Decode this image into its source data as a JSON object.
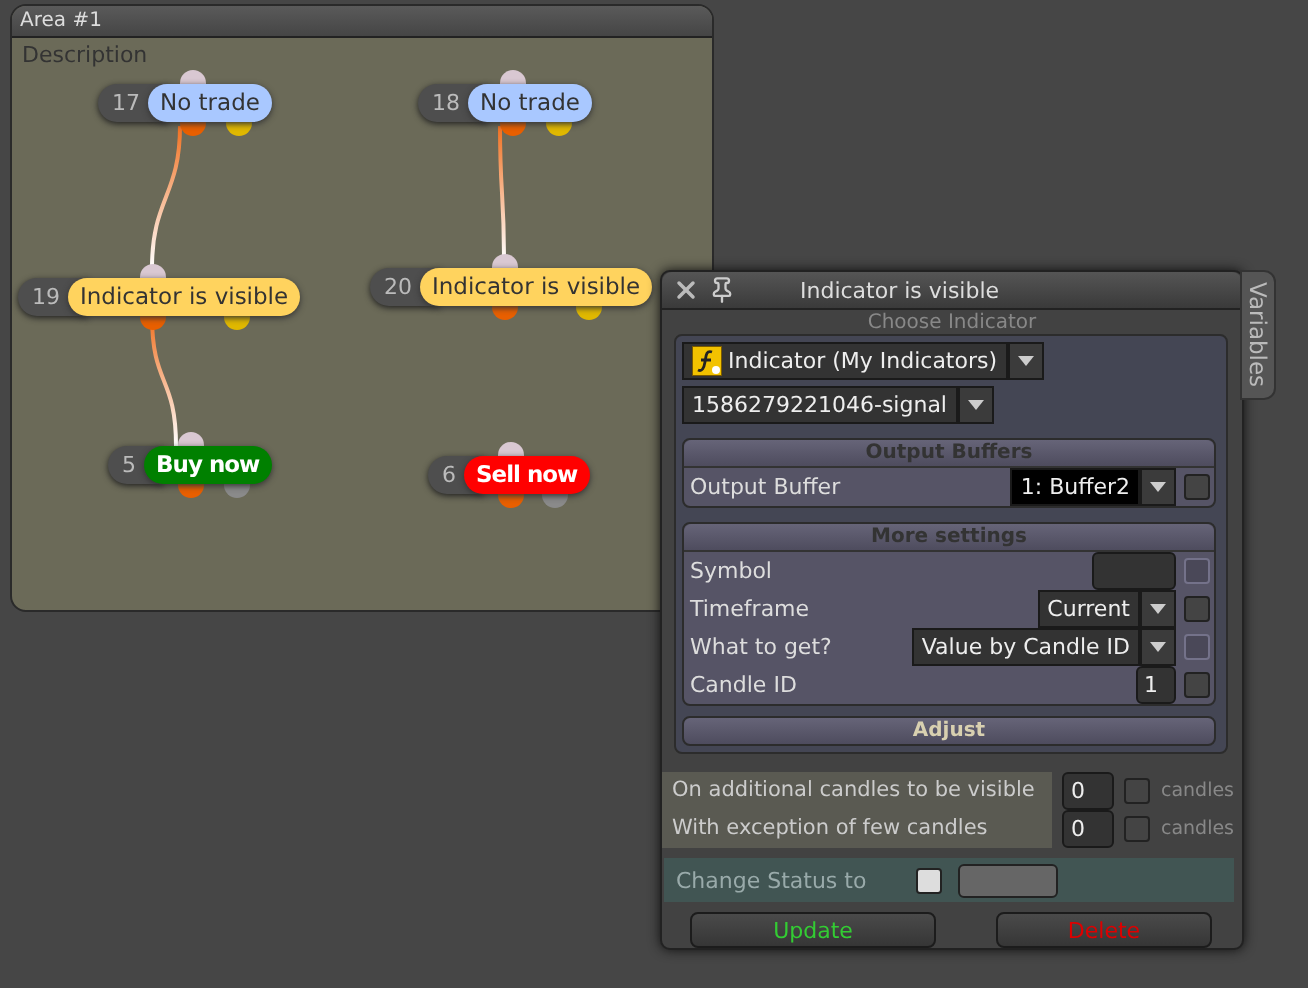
{
  "area": {
    "title": "Area #1",
    "description": "Description",
    "nodes": [
      {
        "number": "17",
        "label": "No trade",
        "color": "#a9c8ff",
        "kind": "condition"
      },
      {
        "number": "18",
        "label": "No trade",
        "color": "#a9c8ff",
        "kind": "condition"
      },
      {
        "number": "19",
        "label": "Indicator is visible",
        "color": "#ffd35e",
        "kind": "condition"
      },
      {
        "number": "20",
        "label": "Indicator is visible",
        "color": "#ffd35e",
        "kind": "condition"
      },
      {
        "number": "5",
        "label": "Buy now",
        "color": "#008000",
        "kind": "action"
      },
      {
        "number": "6",
        "label": "Sell now",
        "color": "#ff0000",
        "kind": "action"
      }
    ]
  },
  "dialog": {
    "title": "Indicator is visible",
    "side_tab": "Variables",
    "choose_header": "Choose Indicator",
    "indicator_select": "Indicator (My Indicators)",
    "signal_select": "1586279221046-signal",
    "sections": [
      {
        "title": "Output Buffers",
        "rows": [
          {
            "label": "Output Buffer",
            "kind": "select",
            "value": "1: Buffer2",
            "checked": false,
            "disabled": false
          }
        ]
      },
      {
        "title": "More settings",
        "rows": [
          {
            "label": "Symbol",
            "kind": "input",
            "value": "",
            "checked": false,
            "disabled": true
          },
          {
            "label": "Timeframe",
            "kind": "select",
            "value": "Current",
            "checked": false,
            "disabled": false
          },
          {
            "label": "What to get?",
            "kind": "select",
            "value": "Value by Candle ID",
            "checked": false,
            "disabled": true
          },
          {
            "label": "Candle ID",
            "kind": "input",
            "value": "1",
            "checked": false,
            "disabled": false
          }
        ]
      }
    ],
    "adjust": "Adjust",
    "candle_rows": [
      {
        "label": "On additional candles to be visible",
        "value": "0",
        "checked": false,
        "unit": "candles"
      },
      {
        "label": "With exception of few candles",
        "value": "0",
        "checked": false,
        "unit": "candles"
      }
    ],
    "status": {
      "label": "Change Status to",
      "checked": false
    },
    "buttons": [
      {
        "label": "Update",
        "kind": "update"
      },
      {
        "label": "Delete",
        "kind": "delete"
      }
    ]
  }
}
